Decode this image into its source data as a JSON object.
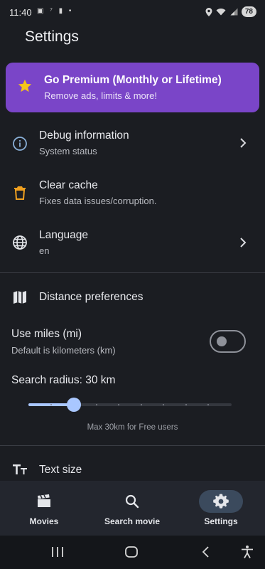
{
  "status_bar": {
    "time": "11:40",
    "left_icons": "▣ ⁷ ▮ •",
    "battery": "78"
  },
  "page": {
    "title": "Settings"
  },
  "premium": {
    "title": "Go Premium (Monthly or Lifetime)",
    "subtitle": "Remove ads, limits & more!",
    "color": "#7a45c8"
  },
  "settings": {
    "debug": {
      "title": "Debug information",
      "subtitle": "System status",
      "icon": "info-icon"
    },
    "cache": {
      "title": "Clear cache",
      "subtitle": "Fixes data issues/corruption.",
      "icon": "trash-icon"
    },
    "language": {
      "title": "Language",
      "subtitle": "en",
      "icon": "globe-icon"
    }
  },
  "distance": {
    "section_title": "Distance preferences",
    "use_miles_title": "Use miles (mi)",
    "use_miles_sub": "Default is kilometers (km)",
    "use_miles_on": false,
    "radius_label": "Search radius: 30 km",
    "slider_note": "Max 30km for Free users",
    "slider_value_fraction": 0.22,
    "accent": "#a9c7ff"
  },
  "text_size": {
    "title": "Text size",
    "icon": "text-size-icon"
  },
  "bottom_nav": {
    "items": [
      {
        "label": "Movies",
        "icon": "clapperboard-icon",
        "selected": false
      },
      {
        "label": "Search movie",
        "icon": "search-icon",
        "selected": false
      },
      {
        "label": "Settings",
        "icon": "gear-icon",
        "selected": true
      }
    ]
  },
  "system_nav": [
    "recents-icon",
    "home-icon",
    "back-icon",
    "accessibility-icon"
  ]
}
